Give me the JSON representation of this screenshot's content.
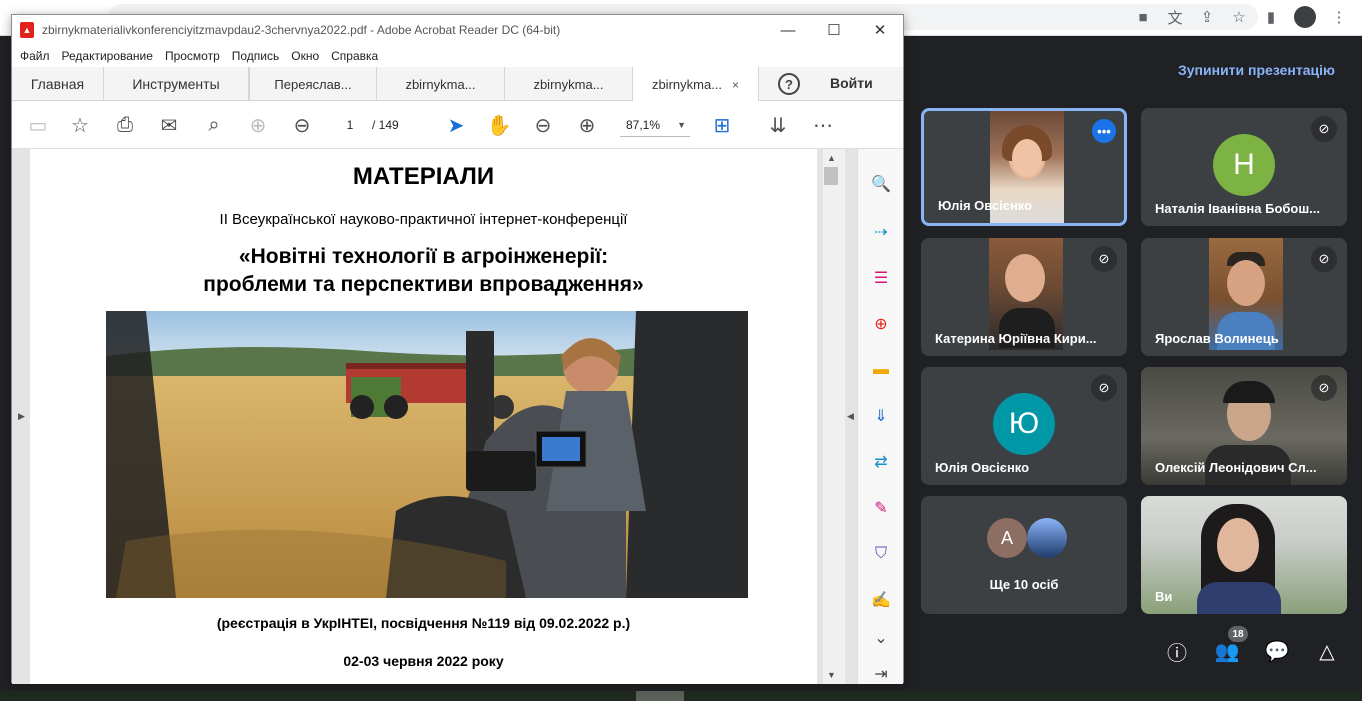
{
  "browser": {
    "omnibox_text": "",
    "avatar_label": ""
  },
  "acrobat": {
    "title": "zbirnykmaterialivkonferenciyitzmavpdau2-3chervnya2022.pdf - Adobe Acrobat Reader DC (64-bit)",
    "menu": [
      "Файл",
      "Редактирование",
      "Просмотр",
      "Подпись",
      "Окно",
      "Справка"
    ],
    "tabs": {
      "home": "Главная",
      "tools": "Инструменты",
      "doc1": "Переяслав...",
      "doc2": "zbirnykma...",
      "doc3": "zbirnykma...",
      "doc4": "zbirnykma...",
      "close": "×"
    },
    "help_label": "?",
    "signin_label": "Войти",
    "toolbar": {
      "page_current": "1",
      "page_total": "/  149",
      "zoom": "87,1%"
    },
    "document": {
      "heading": "МАТЕРІАЛИ",
      "subheading": "ІІ Всеукраїнської науково-практичної інтернет-конференції",
      "title_line1": "«Новітні технології в агроінженерії:",
      "title_line2": "проблеми та перспективи впровадження»",
      "registration": "(реєстрація в УкрІНТЕІ, посвідчення №119 від 09.02.2022 р.)",
      "dates": "02-03 червня 2022 року"
    }
  },
  "meet": {
    "stop_presentation": "Зупинити презентацію",
    "participants": [
      {
        "name": "Юлія Овсієнко",
        "kind": "video",
        "active": true
      },
      {
        "name": "Наталія Іванівна Бобош...",
        "kind": "avatar",
        "initial": "Н",
        "color": "#7cb342"
      },
      {
        "name": "Катерина Юріївна Кири...",
        "kind": "video"
      },
      {
        "name": "Ярослав Волинець",
        "kind": "video"
      },
      {
        "name": "Юлія Овсієнко",
        "kind": "avatar",
        "initial": "Ю",
        "color": "#0097a7"
      },
      {
        "name": "Олексій Леонідович Сл...",
        "kind": "video"
      },
      {
        "name": "Ще 10 осіб",
        "kind": "group",
        "initial": "А",
        "color": "#8d6e63"
      },
      {
        "name": "Ви",
        "kind": "video"
      }
    ],
    "participant_count": "18"
  }
}
